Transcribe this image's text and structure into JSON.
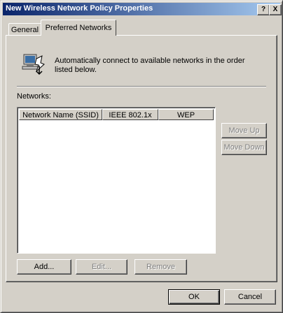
{
  "window": {
    "title": "New Wireless Network Policy Properties"
  },
  "titlebar": {
    "help": "?",
    "close": "X"
  },
  "tabs": [
    {
      "label": "General"
    },
    {
      "label": "Preferred Networks"
    }
  ],
  "description": "Automatically connect to available networks in the order listed below.",
  "networks": {
    "label": "Networks:",
    "columns": [
      "Network Name (SSID)",
      "IEEE 802.1x",
      "WEP"
    ],
    "rows": []
  },
  "buttons": {
    "move_up": "Move Up",
    "move_down": "Move Down",
    "add": "Add...",
    "edit": "Edit...",
    "remove": "Remove",
    "ok": "OK",
    "cancel": "Cancel"
  },
  "icons": {
    "network": "wireless-network-icon"
  }
}
